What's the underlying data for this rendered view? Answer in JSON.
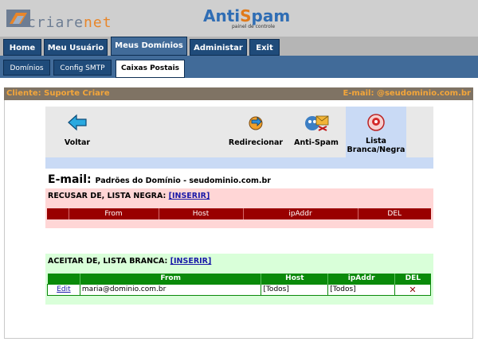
{
  "header": {
    "logo_text_a": "criare",
    "logo_text_b": "net",
    "product_a": "Anti",
    "product_b": "S",
    "product_c": "pam",
    "product_sub": "painel de controle"
  },
  "main_tabs": [
    {
      "label": "Home"
    },
    {
      "label": "Meu Usuário"
    },
    {
      "label": "Meus Domínios",
      "active": true
    },
    {
      "label": "Administar"
    },
    {
      "label": "Exit"
    }
  ],
  "sub_tabs": [
    {
      "label": "Domínios"
    },
    {
      "label": "Config SMTP"
    },
    {
      "label": "Caixas Postais",
      "active": true
    }
  ],
  "client_bar": {
    "client": "Cliente: Suporte Criare",
    "email": "E-mail: @seudominio.com.br"
  },
  "toolbar": {
    "voltar": "Voltar",
    "redirecionar": "Redirecionar",
    "antispam": "Anti-Spam",
    "lista_line1": "Lista",
    "lista_line2": "Branca/Negra"
  },
  "title": {
    "main": "E-mail:",
    "sub": "Padrões do Domínio - seudominio.com.br"
  },
  "blacklist": {
    "heading": "RECUSAR DE, LISTA NEGRA:",
    "insert": "[INSERIR]",
    "columns": [
      "",
      "From",
      "Host",
      "ipAddr",
      "DEL"
    ]
  },
  "whitelist": {
    "heading": "ACEITAR DE, LISTA BRANCA:",
    "insert": "[INSERIR]",
    "columns": [
      "",
      "From",
      "Host",
      "ipAddr",
      "DEL"
    ],
    "rows": [
      {
        "edit": "Edit",
        "from": "maria@dominio.com.br",
        "host": "[Todos]",
        "ipaddr": "[Todos]",
        "del": "✕"
      }
    ]
  },
  "colors": {
    "nav_dark": "#1f4b7a",
    "nav_active": "#416b99",
    "client_bar_bg": "#7f7364",
    "client_bar_text": "#f4a63a",
    "blacklist_bg": "#ffd6d6",
    "blacklist_header": "#990000",
    "whitelist_bg": "#d9ffd9",
    "whitelist_header": "#0a8a0a"
  },
  "icons": {
    "back": "arrow-left-icon",
    "redirect": "redirect-icon",
    "antispam": "antispam-icon",
    "list": "list-badge-icon",
    "delete": "delete-x-icon"
  }
}
